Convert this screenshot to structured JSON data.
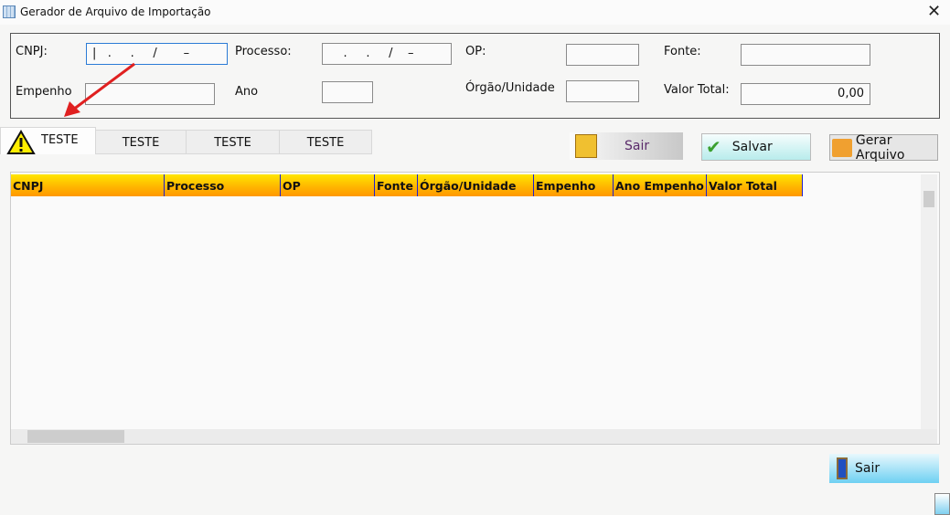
{
  "window": {
    "title": "Gerador de Arquivo de Importação",
    "close": "✕"
  },
  "form": {
    "cnpj_label": "CNPJ:",
    "cnpj_value": "|   .     .     /       –",
    "processo_label": "Processo:",
    "processo_value": "    .     .     /    –",
    "op_label": "OP:",
    "op_value": "",
    "fonte_label": "Fonte:",
    "fonte_value": "",
    "empenho_label": "Empenho",
    "empenho_value": "",
    "ano_label": "Ano",
    "ano_value": "",
    "orgao_label": "Órgão/Unidade",
    "orgao_value": "",
    "valor_label": "Valor Total:",
    "valor_value": "0,00"
  },
  "tabs": [
    {
      "label": "TESTE"
    },
    {
      "label": "TESTE"
    },
    {
      "label": "TESTE"
    },
    {
      "label": "TESTE"
    }
  ],
  "buttons": {
    "sair_top": "Sair",
    "salvar": "Salvar",
    "gerar": "Gerar Arquivo",
    "sair_bottom": "Sair"
  },
  "grid": {
    "columns": [
      "CNPJ",
      "Processo",
      "OP",
      "Fonte",
      "Órgão/Unidade",
      "Empenho",
      "Ano Empenho",
      "Valor Total"
    ]
  },
  "colors": {
    "header_top": "#ffe600",
    "header_bottom": "#ff9800",
    "arrow": "#e02020"
  }
}
